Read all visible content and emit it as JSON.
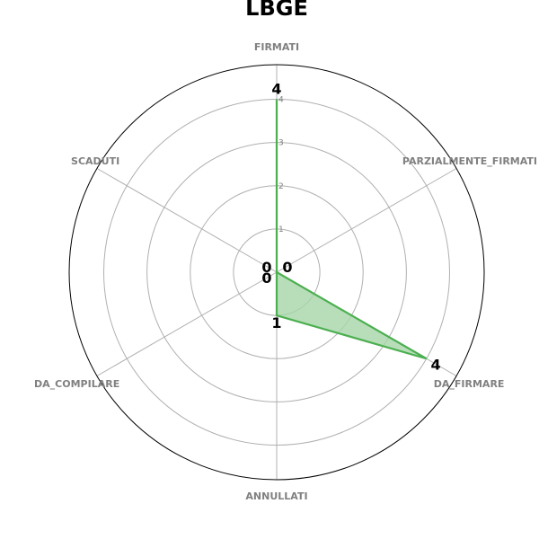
{
  "chart_data": {
    "type": "radar",
    "title": "LBGE",
    "categories": [
      "FIRMATI",
      "PARZIALMENTE_FIRMATI",
      "DA_FIRMARE",
      "ANNULLATI",
      "DA_COMPILARE",
      "SCADUTI"
    ],
    "series": [
      {
        "values": [
          4,
          0,
          4,
          1,
          0,
          0
        ]
      }
    ],
    "r_ticks": [
      "1",
      "2",
      "3",
      "4"
    ],
    "rlim": [
      0,
      4.8
    ],
    "grid": true,
    "colors": {
      "line": "#4caf50",
      "fill": "#a5d6a7",
      "grid": "#b0b0b0",
      "frame": "#000000"
    }
  }
}
